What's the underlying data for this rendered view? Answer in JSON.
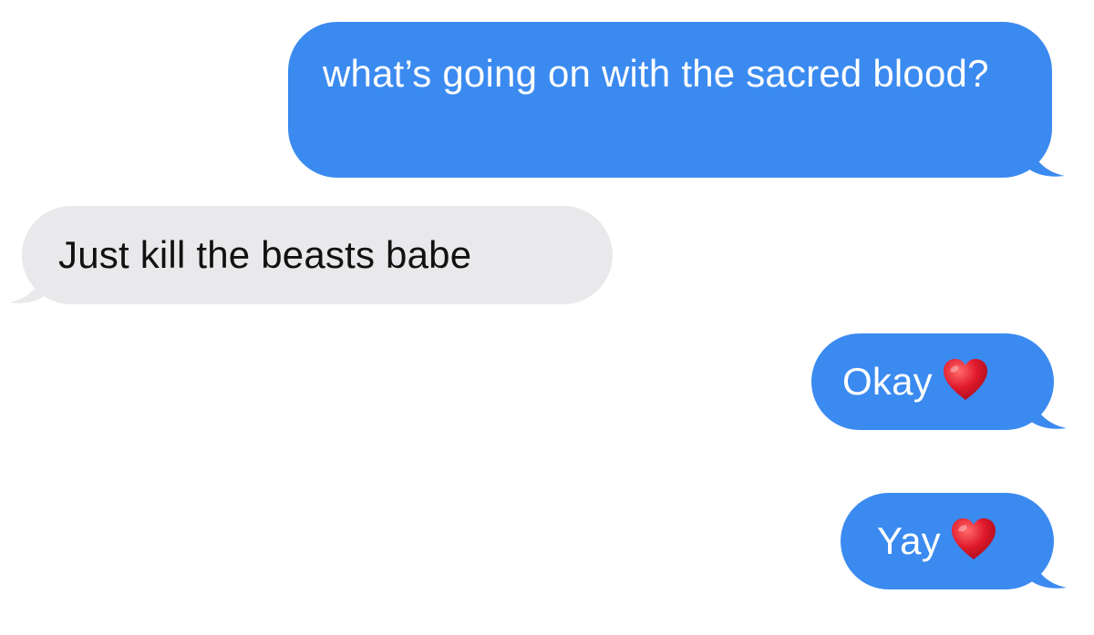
{
  "conversation": {
    "messages": [
      {
        "direction": "sent",
        "text": "what’s going on with the sacred blood?",
        "emoji": ""
      },
      {
        "direction": "received",
        "text": "Just kill the beasts babe",
        "emoji": ""
      },
      {
        "direction": "sent",
        "text": "Okay",
        "emoji": "red-heart-icon"
      },
      {
        "direction": "sent",
        "text": "Yay",
        "emoji": "red-heart-icon"
      }
    ]
  },
  "colors": {
    "sent_bubble": "#3b8af0",
    "received_bubble": "#e9e9eb",
    "sent_text": "#ffffff",
    "received_text": "#111111",
    "heart": "#e0192b"
  }
}
